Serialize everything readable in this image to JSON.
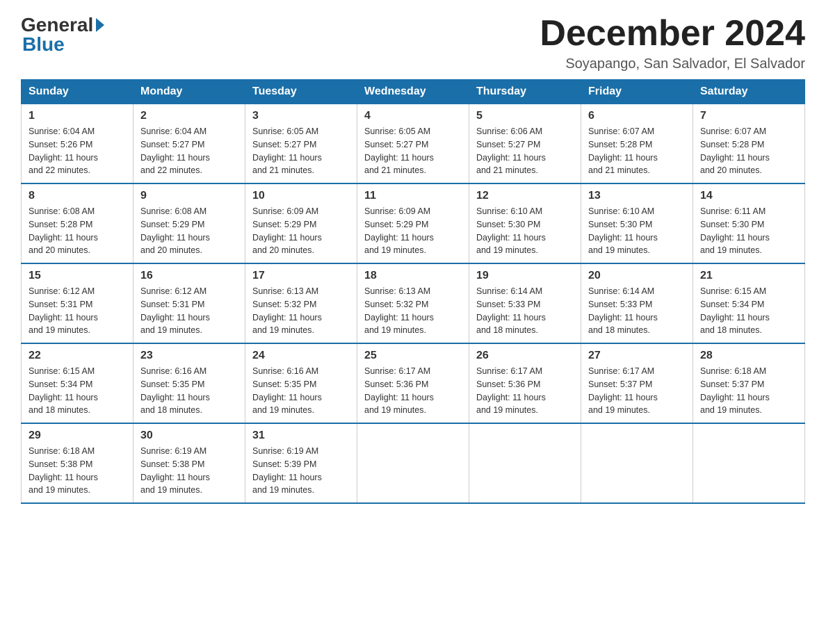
{
  "logo": {
    "general": "General",
    "blue": "Blue"
  },
  "title": "December 2024",
  "location": "Soyapango, San Salvador, El Salvador",
  "days_of_week": [
    "Sunday",
    "Monday",
    "Tuesday",
    "Wednesday",
    "Thursday",
    "Friday",
    "Saturday"
  ],
  "weeks": [
    [
      {
        "day": "1",
        "sunrise": "6:04 AM",
        "sunset": "5:26 PM",
        "daylight": "11 hours and 22 minutes."
      },
      {
        "day": "2",
        "sunrise": "6:04 AM",
        "sunset": "5:27 PM",
        "daylight": "11 hours and 22 minutes."
      },
      {
        "day": "3",
        "sunrise": "6:05 AM",
        "sunset": "5:27 PM",
        "daylight": "11 hours and 21 minutes."
      },
      {
        "day": "4",
        "sunrise": "6:05 AM",
        "sunset": "5:27 PM",
        "daylight": "11 hours and 21 minutes."
      },
      {
        "day": "5",
        "sunrise": "6:06 AM",
        "sunset": "5:27 PM",
        "daylight": "11 hours and 21 minutes."
      },
      {
        "day": "6",
        "sunrise": "6:07 AM",
        "sunset": "5:28 PM",
        "daylight": "11 hours and 21 minutes."
      },
      {
        "day": "7",
        "sunrise": "6:07 AM",
        "sunset": "5:28 PM",
        "daylight": "11 hours and 20 minutes."
      }
    ],
    [
      {
        "day": "8",
        "sunrise": "6:08 AM",
        "sunset": "5:28 PM",
        "daylight": "11 hours and 20 minutes."
      },
      {
        "day": "9",
        "sunrise": "6:08 AM",
        "sunset": "5:29 PM",
        "daylight": "11 hours and 20 minutes."
      },
      {
        "day": "10",
        "sunrise": "6:09 AM",
        "sunset": "5:29 PM",
        "daylight": "11 hours and 20 minutes."
      },
      {
        "day": "11",
        "sunrise": "6:09 AM",
        "sunset": "5:29 PM",
        "daylight": "11 hours and 19 minutes."
      },
      {
        "day": "12",
        "sunrise": "6:10 AM",
        "sunset": "5:30 PM",
        "daylight": "11 hours and 19 minutes."
      },
      {
        "day": "13",
        "sunrise": "6:10 AM",
        "sunset": "5:30 PM",
        "daylight": "11 hours and 19 minutes."
      },
      {
        "day": "14",
        "sunrise": "6:11 AM",
        "sunset": "5:30 PM",
        "daylight": "11 hours and 19 minutes."
      }
    ],
    [
      {
        "day": "15",
        "sunrise": "6:12 AM",
        "sunset": "5:31 PM",
        "daylight": "11 hours and 19 minutes."
      },
      {
        "day": "16",
        "sunrise": "6:12 AM",
        "sunset": "5:31 PM",
        "daylight": "11 hours and 19 minutes."
      },
      {
        "day": "17",
        "sunrise": "6:13 AM",
        "sunset": "5:32 PM",
        "daylight": "11 hours and 19 minutes."
      },
      {
        "day": "18",
        "sunrise": "6:13 AM",
        "sunset": "5:32 PM",
        "daylight": "11 hours and 19 minutes."
      },
      {
        "day": "19",
        "sunrise": "6:14 AM",
        "sunset": "5:33 PM",
        "daylight": "11 hours and 18 minutes."
      },
      {
        "day": "20",
        "sunrise": "6:14 AM",
        "sunset": "5:33 PM",
        "daylight": "11 hours and 18 minutes."
      },
      {
        "day": "21",
        "sunrise": "6:15 AM",
        "sunset": "5:34 PM",
        "daylight": "11 hours and 18 minutes."
      }
    ],
    [
      {
        "day": "22",
        "sunrise": "6:15 AM",
        "sunset": "5:34 PM",
        "daylight": "11 hours and 18 minutes."
      },
      {
        "day": "23",
        "sunrise": "6:16 AM",
        "sunset": "5:35 PM",
        "daylight": "11 hours and 18 minutes."
      },
      {
        "day": "24",
        "sunrise": "6:16 AM",
        "sunset": "5:35 PM",
        "daylight": "11 hours and 19 minutes."
      },
      {
        "day": "25",
        "sunrise": "6:17 AM",
        "sunset": "5:36 PM",
        "daylight": "11 hours and 19 minutes."
      },
      {
        "day": "26",
        "sunrise": "6:17 AM",
        "sunset": "5:36 PM",
        "daylight": "11 hours and 19 minutes."
      },
      {
        "day": "27",
        "sunrise": "6:17 AM",
        "sunset": "5:37 PM",
        "daylight": "11 hours and 19 minutes."
      },
      {
        "day": "28",
        "sunrise": "6:18 AM",
        "sunset": "5:37 PM",
        "daylight": "11 hours and 19 minutes."
      }
    ],
    [
      {
        "day": "29",
        "sunrise": "6:18 AM",
        "sunset": "5:38 PM",
        "daylight": "11 hours and 19 minutes."
      },
      {
        "day": "30",
        "sunrise": "6:19 AM",
        "sunset": "5:38 PM",
        "daylight": "11 hours and 19 minutes."
      },
      {
        "day": "31",
        "sunrise": "6:19 AM",
        "sunset": "5:39 PM",
        "daylight": "11 hours and 19 minutes."
      },
      null,
      null,
      null,
      null
    ]
  ],
  "labels": {
    "sunrise": "Sunrise:",
    "sunset": "Sunset:",
    "daylight": "Daylight:"
  }
}
